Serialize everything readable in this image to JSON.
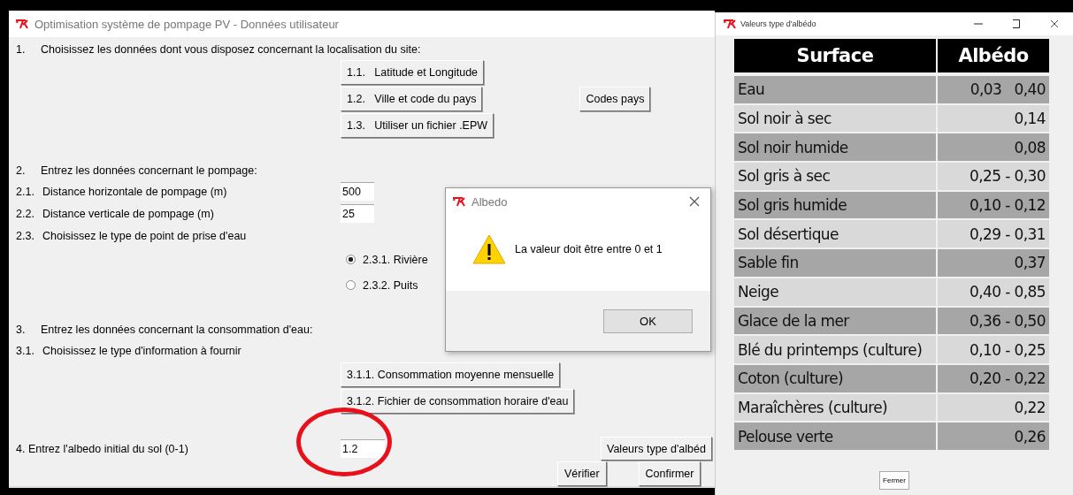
{
  "main_window": {
    "title": "Optimisation système de pompage PV - Données utilisateur",
    "rows": [
      {
        "kind": "heading",
        "number": "1.",
        "text": "Choisissez les données dont vous disposez concernant la localisation du site:"
      },
      {
        "kind": "button",
        "label": "1.1.   Latitude et Longitude"
      },
      {
        "kind": "button",
        "label": "1.2.   Ville et code du pays",
        "side_button": "Codes pays"
      },
      {
        "kind": "button",
        "label": "1.3.   Utiliser un fichier .EPW"
      },
      {
        "kind": "heading",
        "number": "2.",
        "text": "Entrez les données concernant le pompage:"
      },
      {
        "kind": "field",
        "number": "2.1.",
        "text": "Distance horizontale de pompage (m)",
        "value": "500"
      },
      {
        "kind": "field",
        "number": "2.2.",
        "text": "Distance verticale de pompage (m)",
        "value": "25"
      },
      {
        "kind": "label",
        "number": "2.3.",
        "text": "Choisissez le type de point de prise d'eau"
      },
      {
        "kind": "radio",
        "label": "2.3.1. Rivière",
        "selected": true
      },
      {
        "kind": "radio",
        "label": "2.3.2. Puits",
        "selected": false
      },
      {
        "kind": "heading",
        "number": "3.",
        "text": "Entrez les données concernant la consommation d'eau:"
      },
      {
        "kind": "label",
        "number": "3.1.",
        "text": "Choisissez le type d'information à fournir"
      },
      {
        "kind": "button",
        "label": "3.1.1. Consommation moyenne mensuelle"
      },
      {
        "kind": "button",
        "label": "3.1.2. Fichier de consommation horaire d'eau"
      },
      {
        "kind": "final_field",
        "text": "4. Entrez l'albedo initial du sol (0-1)",
        "value": "1.2",
        "side_button": "Valeurs type d'albéd"
      }
    ],
    "buttons": [
      "Vérifier",
      "Confirmer"
    ]
  },
  "dialog": {
    "title": "Albedo",
    "message": "La valeur doit être entre 0 et 1",
    "button": "OK"
  },
  "albedo_window": {
    "title": "Valeurs type d'albédo",
    "columns": [
      "Surface",
      "Albédo"
    ],
    "rows": [
      [
        "Eau",
        "0,03   0,40"
      ],
      [
        "Sol noir à sec",
        "0,14"
      ],
      [
        "Sol noir humide",
        "0,08"
      ],
      [
        "Sol gris à sec",
        "0,25 - 0,30"
      ],
      [
        "Sol gris humide",
        "0,10 - 0,12"
      ],
      [
        "Sol désertique",
        "0,29 - 0,31"
      ],
      [
        "Sable fin",
        "0,37"
      ],
      [
        "Neige",
        "0,40 - 0,85"
      ],
      [
        "Glace de la mer",
        "0,36 - 0,50"
      ],
      [
        "Blé du printemps (culture)",
        "0,10 - 0,25"
      ],
      [
        "Coton (culture)",
        "0,20 - 0,22"
      ],
      [
        "Maraîchères (culture)",
        "0,22"
      ],
      [
        "Pelouse verte",
        "0,26"
      ]
    ],
    "button": "Fermer"
  }
}
